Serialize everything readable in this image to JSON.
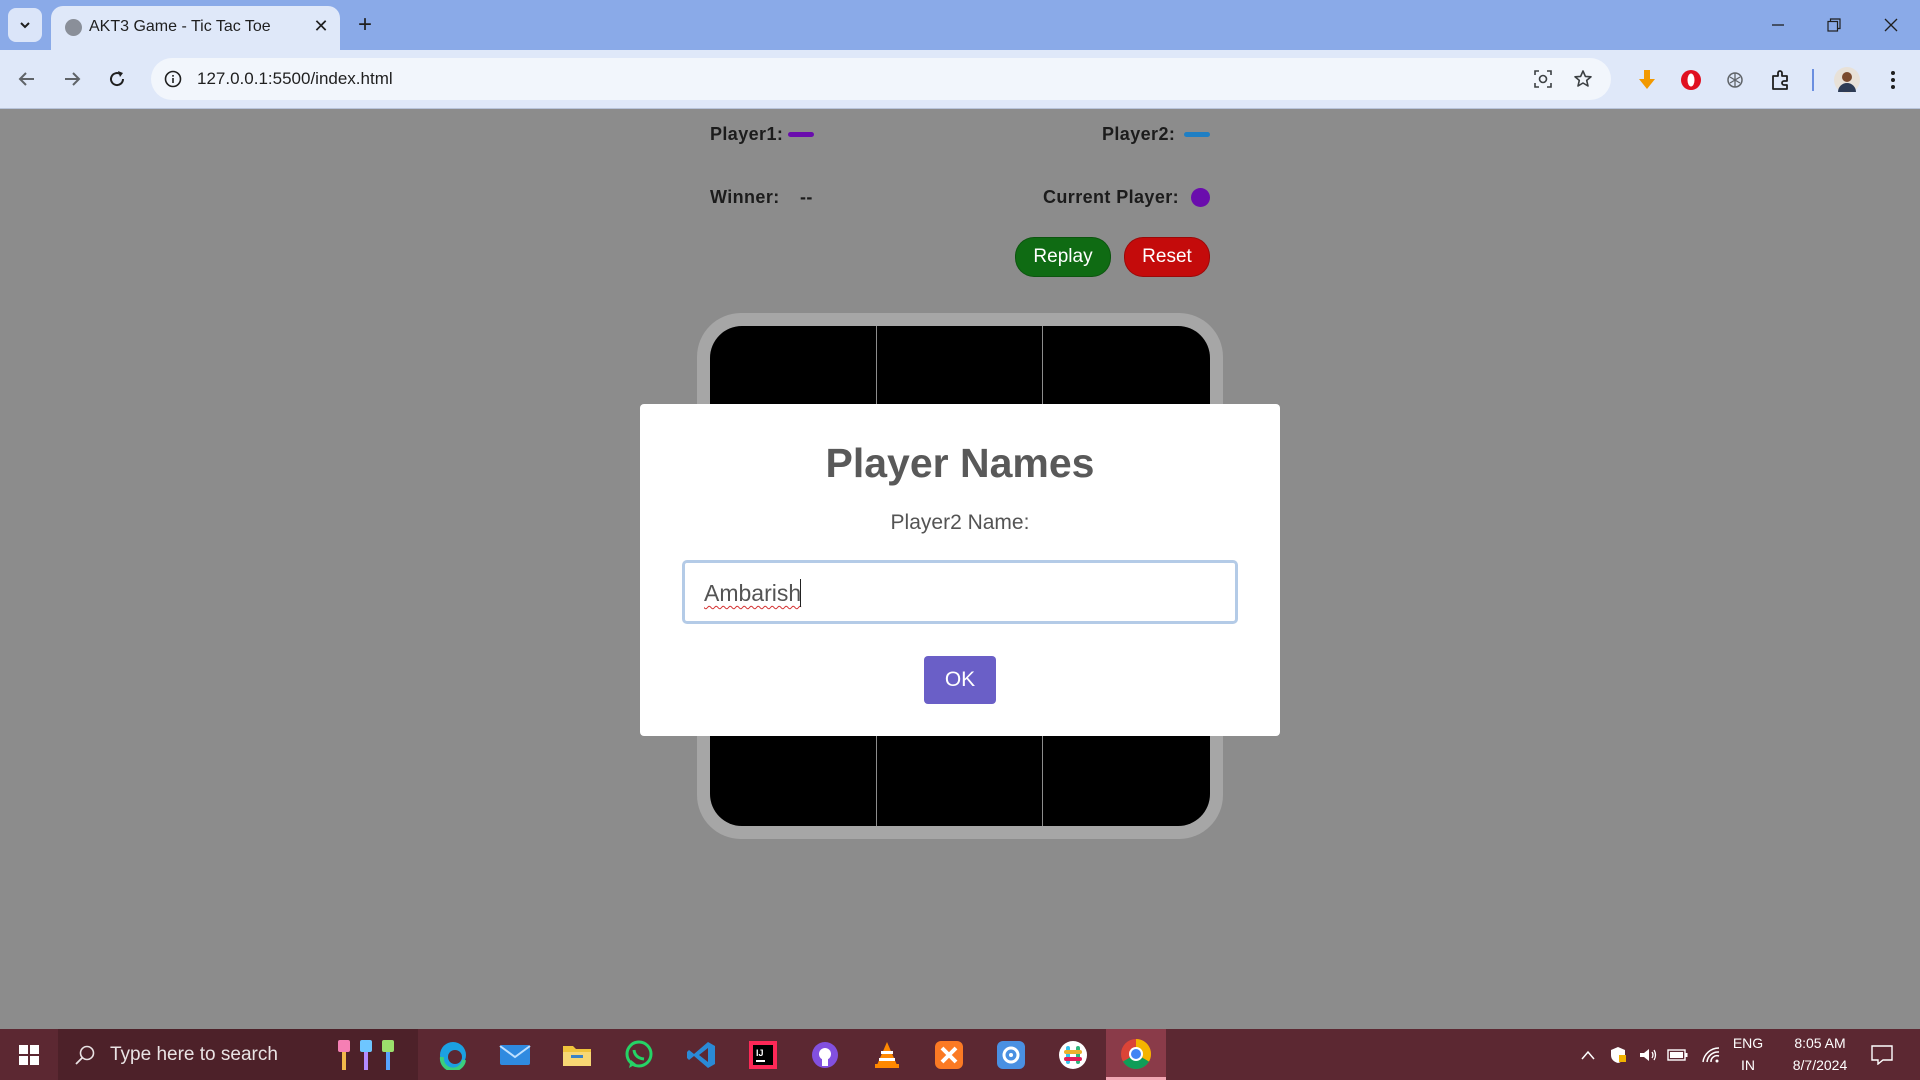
{
  "browser": {
    "tab_title": "AKT3 Game - Tic Tac Toe",
    "url": "127.0.0.1:5500/index.html"
  },
  "game": {
    "player1_label": "Player1:",
    "player2_label": "Player2:",
    "winner_label": "Winner:",
    "winner_value": "--",
    "current_player_label": "Current Player:",
    "replay_label": "Replay",
    "reset_label": "Reset",
    "colors": {
      "player1": "#6a0dad",
      "player2": "#1f7fc4",
      "current_player": "#6a0dad",
      "replay": "#0f6b13",
      "reset": "#c40b0b"
    }
  },
  "modal": {
    "title": "Player Names",
    "label": "Player2 Name:",
    "input_value": "Ambarish",
    "ok_label": "OK"
  },
  "taskbar": {
    "search_placeholder": "Type here to search",
    "language": "ENG",
    "region": "IN",
    "time": "8:05 AM",
    "date": "8/7/2024",
    "pinned_apps": [
      "paint-brushes",
      "edge",
      "mail",
      "file-explorer",
      "whatsapp",
      "vscode",
      "intellij",
      "github-desktop",
      "vlc",
      "xampp",
      "settings-app",
      "slack",
      "chrome"
    ]
  }
}
